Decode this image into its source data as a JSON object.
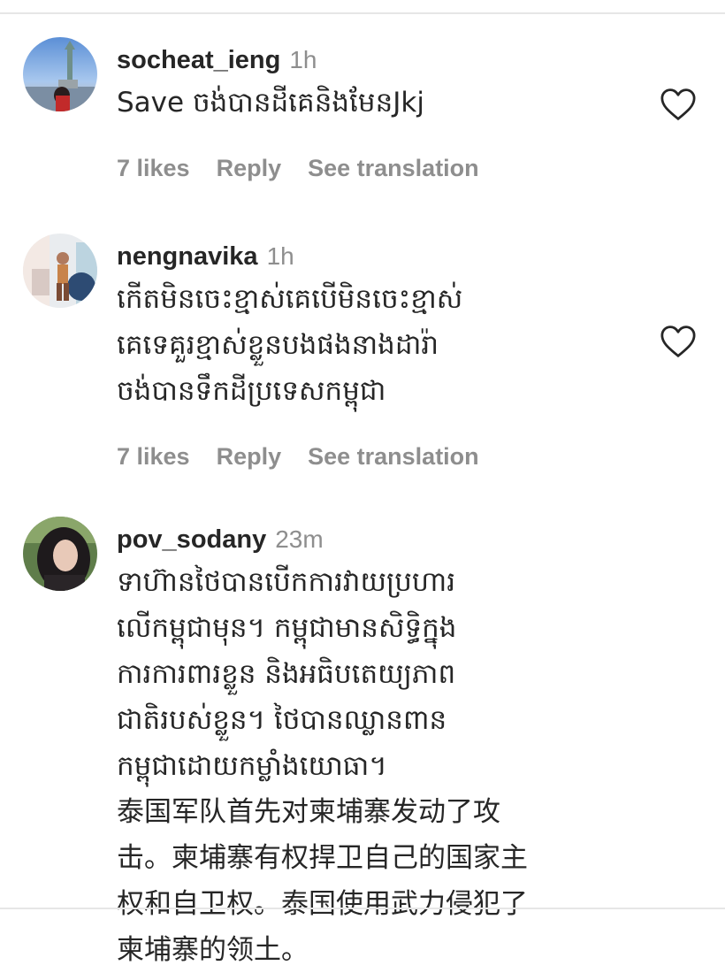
{
  "comments": [
    {
      "username": "socheat_ieng",
      "time": "1h",
      "lines": [
        "Save ចង់បានដីគេនិងមែនJkj"
      ],
      "likes": "7 likes",
      "reply": "Reply",
      "see_translation": "See translation",
      "avatar_icon": "avatar-statue-of-liberty",
      "like_icon": "heart-outline-icon"
    },
    {
      "username": "nengnavika",
      "time": "1h",
      "lines": [
        "កើតមិនចេះខ្មាស់គេបើមិនចេះខ្មាស់",
        "គេទេគួរខ្មាស់ខ្លួនបងផងនាងដារ៉ា",
        "ចង់បានទឹកដីប្រទេសកម្ពុជា"
      ],
      "likes": "7 likes",
      "reply": "Reply",
      "see_translation": "See translation",
      "avatar_icon": "avatar-person-room",
      "like_icon": "heart-outline-icon"
    },
    {
      "username": "pov_sodany",
      "time": "23m",
      "lines": [
        "ទាហ៊ានថៃបានបើកការវាយប្រហារ",
        "លើកម្ពុជាមុន។ កម្ពុជាមានសិទ្ធិក្នុង",
        "ការការពារខ្លួន និងអធិបតេយ្យភាព",
        "ជាតិរបស់ខ្លួន។ ថៃបានឈ្លានពាន",
        "កម្ពុជាដោយកម្លាំងយោធា។",
        "泰国军队首先对柬埔寨发动了攻",
        "击。柬埔寨有权捍卫自己的国家主",
        "权和自卫权。泰国使用武力侵犯了",
        "柬埔寨的领土。"
      ],
      "avatar_icon": "avatar-woman-portrait"
    }
  ],
  "colors": {
    "text": "#262626",
    "secondary": "#8e8e8e",
    "divider": "#e6e6e6"
  }
}
